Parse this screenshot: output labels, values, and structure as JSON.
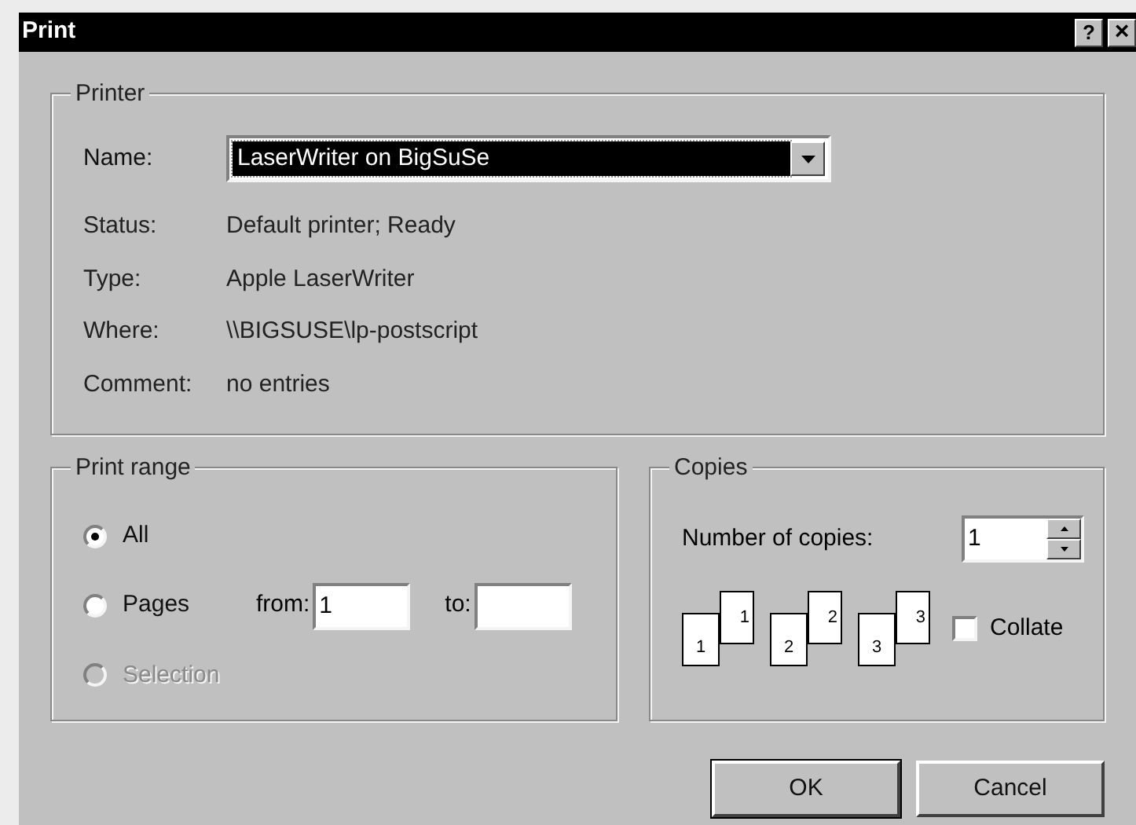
{
  "window": {
    "title": "Print",
    "buttons": [
      {
        "kind": "help",
        "label": "?"
      },
      {
        "kind": "close",
        "label": "×"
      }
    ]
  },
  "printer": {
    "title": "Printer",
    "name_label": "Name:",
    "name_value": "LaserWriter on BigSuSe",
    "info": [
      {
        "label": "Status:",
        "value": "Default printer; Ready"
      },
      {
        "label": "Type:",
        "value": "Apple LaserWriter"
      },
      {
        "label": "Where:",
        "value": "\\\\BIGSUSE\\lp-postscript"
      },
      {
        "label": "Comment:",
        "value": "no entries"
      }
    ]
  },
  "print_range": {
    "title": "Print range",
    "options": [
      {
        "label": "All",
        "selected": true,
        "disabled": false
      },
      {
        "label": "Pages",
        "selected": false,
        "disabled": false
      },
      {
        "label": "Selection",
        "selected": false,
        "disabled": true
      }
    ],
    "from_label": "from:",
    "from_value": "1",
    "to_label": "to:"
  },
  "copies": {
    "title": "Copies",
    "count_label": "Number of copies:",
    "count_value": "1",
    "collate_pages": [
      {
        "front": "1",
        "back": "1"
      },
      {
        "front": "2",
        "back": "2"
      },
      {
        "front": "3",
        "back": "3"
      }
    ],
    "collate": {
      "label": "Collate",
      "checked": false
    }
  },
  "buttons": [
    "OK",
    "Cancel"
  ]
}
